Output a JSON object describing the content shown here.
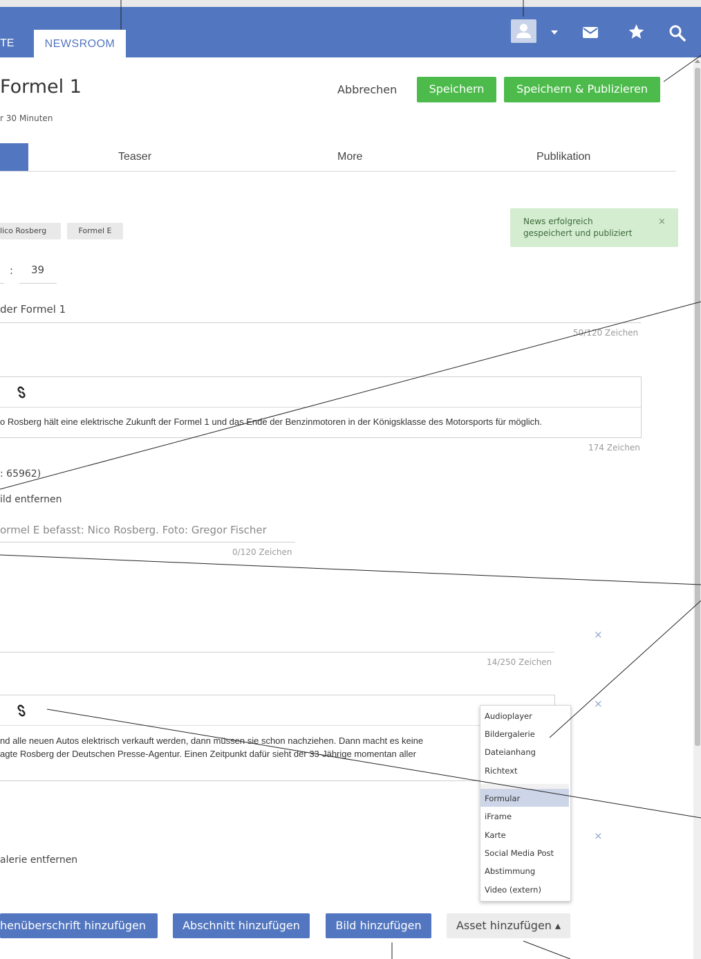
{
  "navbar": {
    "tab_cut_label": "TE",
    "active_tab_label": "NEWSROOM",
    "icons": [
      "user-icon",
      "chevron-down-icon",
      "mail-icon",
      "star-icon",
      "search-icon"
    ],
    "accent_color": "#5276bf"
  },
  "article": {
    "title": "Formel 1",
    "meta": "r 30 Minuten"
  },
  "actions": {
    "cancel_label": "Abbrechen",
    "save_label": "Speichern",
    "save_publish_label": "Speichern & Publizieren"
  },
  "editor_tabs": [
    "",
    "Teaser",
    "More",
    "Publikation"
  ],
  "toast": {
    "message": "News erfolgreich gespeichert und publiziert",
    "close": "×"
  },
  "tags": [
    "lico Rosberg",
    "Formel E"
  ],
  "time": {
    "separator": ":",
    "minutes": "39"
  },
  "headline_field": {
    "value": "der Formel 1",
    "counter": "50/120 Zeichen"
  },
  "lead_field": {
    "text": "o Rosberg hält eine elektrische Zukunft der Formel 1 und das Ende der Benzinmotoren in der Königsklasse des Motorsports für möglich.",
    "counter": "174 Zeichen"
  },
  "image_block": {
    "id_text": ": 65962)",
    "remove_label": "ild entfernen",
    "caption": "ormel E befasst: Nico Rosberg. Foto: Gregor Fischer",
    "caption_counter": "0/120 Zeichen"
  },
  "subtitle_block": {
    "counter": "14/250 Zeichen",
    "close": "×"
  },
  "paragraph_block": {
    "line1": "nd alle neuen Autos elektrisch verkauft werden, dann müssen sie schon nachziehen. Dann macht es keine",
    "line2": "agte Rosberg der Deutschen Presse-Agentur. Einen Zeitpunkt dafür sieht der 33-Jährige momentan aller",
    "close": "×"
  },
  "gallery_block": {
    "remove_label": "alerie entfernen",
    "close": "×"
  },
  "asset_menu": {
    "items_top": [
      "Audioplayer",
      "Bildergalerie",
      "Dateianhang",
      "Richtext"
    ],
    "items_bottom": [
      "Formular",
      "iFrame",
      "Karte",
      "Social Media Post",
      "Abstimmung",
      "Video (extern)"
    ],
    "highlighted": "Formular"
  },
  "bottom_buttons": {
    "heading_label": "henüberschrift hinzufügen",
    "section_label": "Abschnitt hinzufügen",
    "image_label": "Bild hinzufügen",
    "asset_label": "Asset hinzufügen ▴"
  }
}
